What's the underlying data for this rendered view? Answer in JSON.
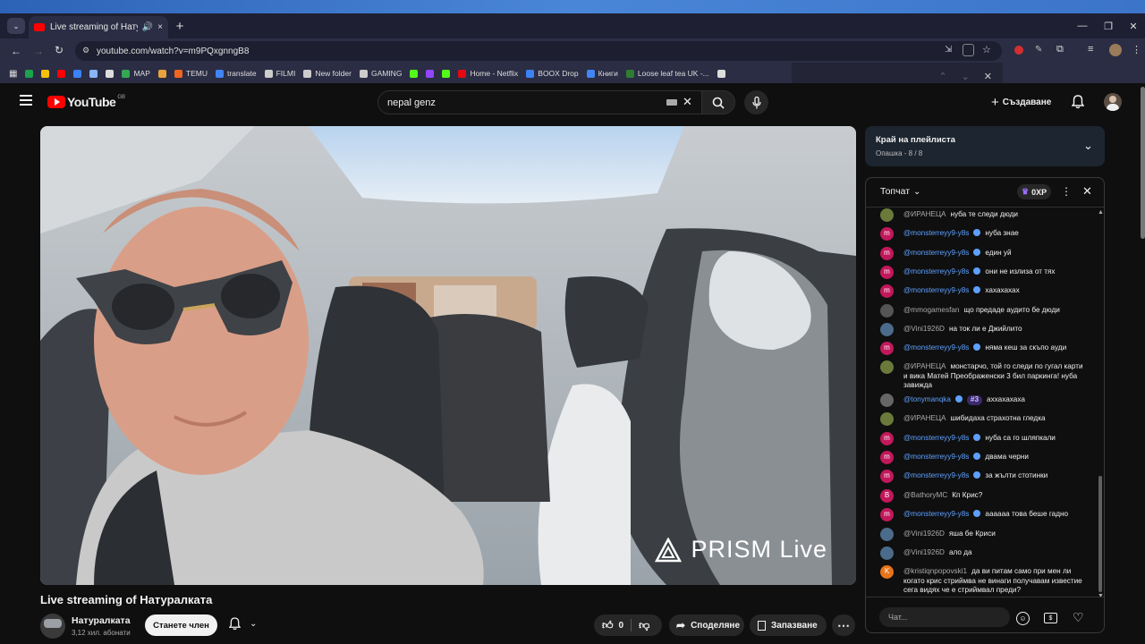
{
  "browser": {
    "tab": {
      "title": "Live streaming of Натуралката",
      "audio_icon": "speaker-icon",
      "close": "×"
    },
    "new_tab": "+",
    "url": "youtube.com/watch?v=m9PQxgnngB8",
    "window_controls": {
      "minimize": "—",
      "maximize": "❐",
      "close": "✕"
    },
    "bookmarks": [
      {
        "label": "",
        "color": "#1aa34a"
      },
      {
        "label": "",
        "color": "#f4c20d"
      },
      {
        "label": "",
        "color": "#ff0000"
      },
      {
        "label": "",
        "color": "#3b82f6"
      },
      {
        "label": "",
        "color": "#8ab4f8"
      },
      {
        "label": "",
        "color": "#dddddd"
      },
      {
        "label": "MAP",
        "color": "#34a853"
      },
      {
        "label": "",
        "color": "#e8a33d"
      },
      {
        "label": "TEMU",
        "color": "#f26522"
      },
      {
        "label": "translate",
        "color": "#4285f4"
      },
      {
        "label": "FILMI",
        "color": "#cccccc"
      },
      {
        "label": "New folder",
        "color": "#cccccc"
      },
      {
        "label": "GAMING",
        "color": "#cccccc"
      },
      {
        "label": "",
        "color": "#53fc18"
      },
      {
        "label": "",
        "color": "#9146ff"
      },
      {
        "label": "",
        "color": "#53fc18"
      },
      {
        "label": "Home - Netflix",
        "color": "#e50914"
      },
      {
        "label": "BOOX Drop",
        "color": "#3b82f6"
      },
      {
        "label": "Книги",
        "color": "#4285f4"
      },
      {
        "label": "Loose leaf tea UK -...",
        "color": "#2e7d32"
      },
      {
        "label": "",
        "color": "#dddddd"
      }
    ]
  },
  "youtube": {
    "logo": "YouTube",
    "region": "GB",
    "search": {
      "value": "nepal genz"
    },
    "create_label": "Създаване"
  },
  "video": {
    "watermark": "PRISM Live",
    "title": "Live streaming of Натуралката",
    "channel": "Натуралката",
    "subscribers": "3,12 хил. абонати",
    "join_label": "Станете член",
    "likes": "0",
    "share_label": "Споделяне",
    "save_label": "Запазване",
    "more": "⋯"
  },
  "playlist": {
    "title": "Край на плейлиста",
    "subtitle": "Опашка - 8 / 8"
  },
  "chat": {
    "header_title": "Топчат",
    "xp_label": "0XP",
    "input_placeholder": "Чат...",
    "messages": [
      {
        "author": "@ИРАНЕЦА",
        "text": "нуба те следи дюди",
        "member": false,
        "avatar_color": "#6b7a3a",
        "avatar_letter": ""
      },
      {
        "author": "@monsterreyy9-y8s",
        "text": "нуба знае",
        "member": true,
        "avatar_color": "#c2185b",
        "avatar_letter": "m"
      },
      {
        "author": "@monsterreyy9-y8s",
        "text": "един уй",
        "member": true,
        "avatar_color": "#c2185b",
        "avatar_letter": "m"
      },
      {
        "author": "@monsterreyy9-y8s",
        "text": "они не излиза от тях",
        "member": true,
        "avatar_color": "#c2185b",
        "avatar_letter": "m"
      },
      {
        "author": "@monsterreyy9-y8s",
        "text": "хахахахах",
        "member": true,
        "avatar_color": "#c2185b",
        "avatar_letter": "m"
      },
      {
        "author": "@mmogamesfan",
        "text": "що предаде аудито бе дюди",
        "member": false,
        "avatar_color": "#555555",
        "avatar_letter": ""
      },
      {
        "author": "@Vini1926D",
        "text": "на ток ли е Джийлито",
        "member": false,
        "avatar_color": "#4a6b8a",
        "avatar_letter": ""
      },
      {
        "author": "@monsterreyy9-y8s",
        "text": "няма кеш за скъпо ауди",
        "member": true,
        "avatar_color": "#c2185b",
        "avatar_letter": "m"
      },
      {
        "author": "@ИРАНЕЦА",
        "text": "монстарчо, той го следи по гугал карти и вика Матей Преображенски 3 бил паркинга! нуба завижда",
        "member": false,
        "avatar_color": "#6b7a3a",
        "avatar_letter": ""
      },
      {
        "author": "@tonymanqka",
        "text": "аххахахаха",
        "member": true,
        "avatar_color": "#666666",
        "avatar_letter": "",
        "badge": "#3"
      },
      {
        "author": "@ИРАНЕЦА",
        "text": "шибидаха страхотна гледка",
        "member": false,
        "avatar_color": "#6b7a3a",
        "avatar_letter": ""
      },
      {
        "author": "@monsterreyy9-y8s",
        "text": "нуба са го шляпкали",
        "member": true,
        "avatar_color": "#c2185b",
        "avatar_letter": "m"
      },
      {
        "author": "@monsterreyy9-y8s",
        "text": "двама черни",
        "member": true,
        "avatar_color": "#c2185b",
        "avatar_letter": "m"
      },
      {
        "author": "@monsterreyy9-y8s",
        "text": "за жълти стотинки",
        "member": true,
        "avatar_color": "#c2185b",
        "avatar_letter": "m"
      },
      {
        "author": "@BathoryMC",
        "text": "Кп Крис?",
        "member": false,
        "avatar_color": "#c2185b",
        "avatar_letter": "B"
      },
      {
        "author": "@monsterreyy9-y8s",
        "text": "аааааа това беше гадно",
        "member": true,
        "avatar_color": "#c2185b",
        "avatar_letter": "m"
      },
      {
        "author": "@Vini1926D",
        "text": "яша бе Криси",
        "member": false,
        "avatar_color": "#4a6b8a",
        "avatar_letter": ""
      },
      {
        "author": "@Vini1926D",
        "text": "ало да",
        "member": false,
        "avatar_color": "#4a6b8a",
        "avatar_letter": ""
      },
      {
        "author": "@kristiqnpopovski1",
        "text": "да ви питам само при мен ли когато крис стриймва не винаги получавам известие сега видях че е стриймвал преди?",
        "member": false,
        "avatar_color": "#e6741a",
        "avatar_letter": "K"
      }
    ]
  }
}
